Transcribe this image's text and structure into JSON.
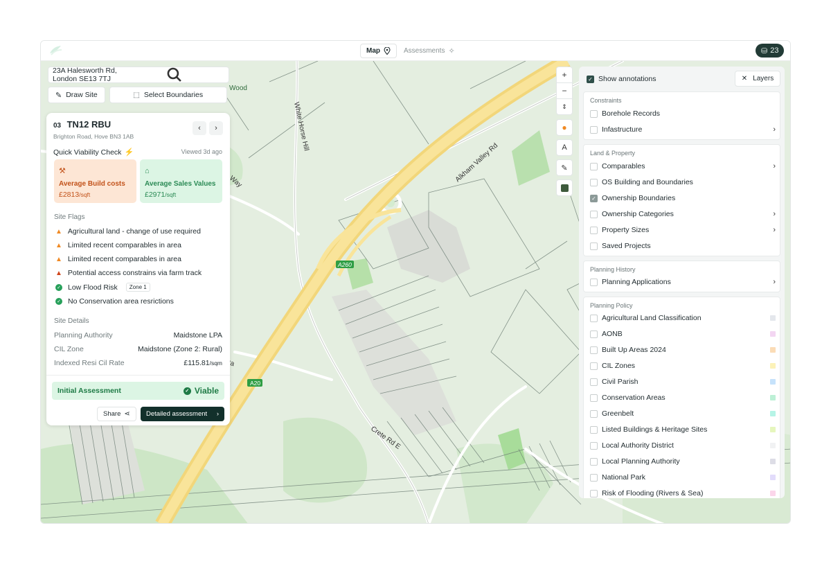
{
  "topbar": {
    "tabs": [
      {
        "label": "Map"
      },
      {
        "label": "Assessments"
      }
    ],
    "credits": "23"
  },
  "search": {
    "value": "23A Halesworth Rd, London SE13 7TJ"
  },
  "tools": {
    "draw_site": "Draw Site",
    "select_boundaries": "Select Boundaries"
  },
  "site": {
    "index": "03",
    "title": "TN12 RBU",
    "address": "Brighton Road, Hove BN3 1AB",
    "quick_check": "Quick Viability Check",
    "viewed": "Viewed 3d ago",
    "build": {
      "label": "Average Build costs",
      "value": "£2813",
      "unit": "/sqft"
    },
    "sales": {
      "label": "Average Sales Values",
      "value": "£2971",
      "unit": "/sqft"
    },
    "flags_title": "Site Flags",
    "flags": [
      {
        "text": "Agricultural land - change of use required",
        "level": "warn"
      },
      {
        "text": "Limited recent comparables in area",
        "level": "warn"
      },
      {
        "text": "Limited recent comparables in area",
        "level": "warn"
      },
      {
        "text": "Potential access constrains via farm track",
        "level": "danger"
      },
      {
        "text": "Low Flood Risk",
        "level": "ok",
        "badge": "Zone 1"
      },
      {
        "text": "No Conservation area resrictions",
        "level": "ok"
      }
    ],
    "details_title": "Site Details",
    "details": [
      {
        "key": "Planning Authority",
        "value": "Maidstone LPA",
        "unit": ""
      },
      {
        "key": "CIL Zone",
        "value": "Maidstone (Zone 2: Rural)",
        "unit": ""
      },
      {
        "key": "Indexed Resi Cil Rate",
        "value": "£115.81",
        "unit": "/sqm"
      }
    ],
    "assessment_label": "Initial Assessment",
    "assessment_result": "Viable",
    "share": "Share",
    "detailed": "Detailed assessment"
  },
  "map_labels": {
    "wood": "Wood",
    "white_horse": "White Horse Hill",
    "alkham": "Alkham Valley Rd",
    "way": "Way",
    "a260": "A260",
    "a20": "A20",
    "ra": "Ra",
    "crete": "Crete Rd E"
  },
  "layers": {
    "show_annotations": "Show annotations",
    "button": "Layers",
    "groups": [
      {
        "title": "Constraints",
        "items": [
          {
            "label": "Borehole Records",
            "checked": false,
            "chevron": false
          },
          {
            "label": "Infastructure",
            "checked": false,
            "chevron": true
          }
        ]
      },
      {
        "title": "Land & Property",
        "items": [
          {
            "label": "Comparables",
            "checked": false,
            "chevron": true
          },
          {
            "label": "OS Building and Boundaries",
            "checked": false,
            "chevron": false
          },
          {
            "label": "Ownership Boundaries",
            "checked": true,
            "chevron": false
          },
          {
            "label": "Ownership Categories",
            "checked": false,
            "chevron": true
          },
          {
            "label": "Property Sizes",
            "checked": false,
            "chevron": true
          },
          {
            "label": "Saved Projects",
            "checked": false,
            "chevron": false
          }
        ]
      },
      {
        "title": "Planning History",
        "items": [
          {
            "label": "Planning Applications",
            "checked": false,
            "chevron": true
          }
        ]
      },
      {
        "title": "Planning Policy",
        "items": [
          {
            "label": "Agricultural Land Classification",
            "swatch": "#e4e7ec"
          },
          {
            "label": "AONB",
            "swatch": "#f3d6f2"
          },
          {
            "label": "Built Up Areas 2024",
            "swatch": "#fbdcb6"
          },
          {
            "label": "CIL Zones",
            "swatch": "#fcf2b8"
          },
          {
            "label": "Civil Parish",
            "swatch": "#c6e2fb"
          },
          {
            "label": "Conservation Areas",
            "swatch": "#bdf0d6"
          },
          {
            "label": "Greenbelt",
            "swatch": "#b6f4e6"
          },
          {
            "label": "Listed Buildings & Heritage Sites",
            "swatch": "#e6f6bd"
          },
          {
            "label": "Local Authority District",
            "swatch": "#f1f2f3"
          },
          {
            "label": "Local Planning Authority",
            "swatch": "#dddde6"
          },
          {
            "label": "National Park",
            "swatch": "#e2dcfb"
          },
          {
            "label": "Risk of Flooding (Rivers & Sea)",
            "swatch": "#fbd6ea"
          }
        ]
      }
    ]
  }
}
